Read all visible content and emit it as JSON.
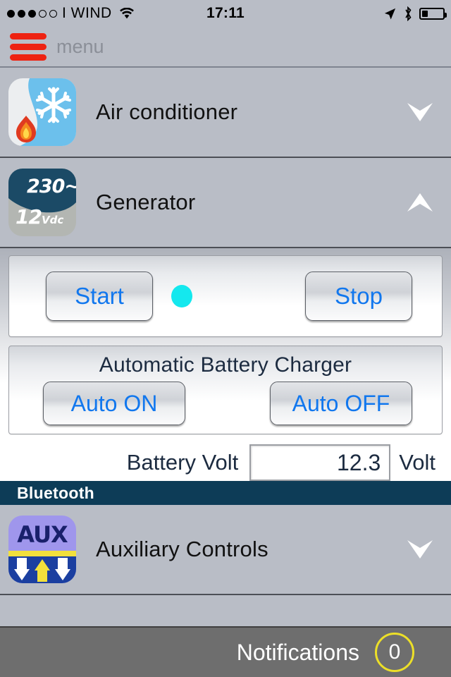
{
  "statusbar": {
    "carrier": "I WIND",
    "time": "17:11",
    "signal_filled": 3,
    "signal_total": 5,
    "battery_percent": 30,
    "icons": [
      "wifi-icon",
      "location-arrow-icon",
      "bluetooth-icon",
      "battery-icon"
    ]
  },
  "menubar": {
    "label": "menu",
    "icon": "hamburger-icon",
    "accent": "#ee2211"
  },
  "rows": [
    {
      "label": "Air conditioner",
      "icon": "air-conditioner-icon",
      "chevron": "chevron-down-icon",
      "expanded": false
    },
    {
      "label": "Generator",
      "icon": "generator-icon",
      "icon_top_text": "230~",
      "icon_bottom_value": "12",
      "icon_bottom_unit": "Vdc",
      "chevron": "chevron-up-icon",
      "expanded": true
    },
    {
      "label": "Auxiliary Controls",
      "icon": "aux-icon",
      "icon_text": "AUX",
      "chevron": "chevron-down-icon",
      "expanded": false
    }
  ],
  "generator_panel": {
    "start_label": "Start",
    "stop_label": "Stop",
    "status_led_color": "#14e8ee",
    "charger_title": "Automatic Battery Charger",
    "auto_on_label": "Auto ON",
    "auto_off_label": "Auto OFF",
    "battery_volt_label": "Battery Volt",
    "battery_volt_value": "12.3",
    "battery_volt_unit": "Volt"
  },
  "section_header": {
    "label": "Bluetooth",
    "color": "#0d3c57"
  },
  "bottombar": {
    "notifications_label": "Notifications",
    "notifications_count": "0",
    "badge_color": "#ecdf28"
  }
}
